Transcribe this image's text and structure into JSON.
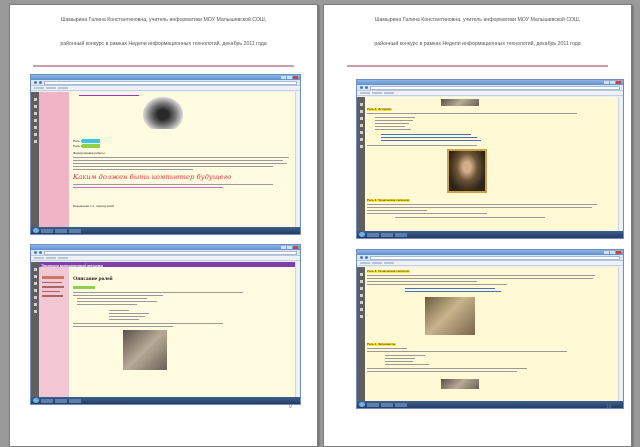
{
  "header": {
    "line1": "Шамырина Галина Константиновна, учитель информатики   МОУ Малышевской СОШ,",
    "line2": "районный конкурс в рамках Недели  информационных технологий, декабрь 2011 года"
  },
  "pages": {
    "left_number": "9",
    "right_number": "10"
  },
  "shot1": {
    "label_a": "Роль 1",
    "label_b": "Роль 2",
    "heading": "Формулировка работы:",
    "slogan": "Каким должен быть компьютер будущего",
    "footer": "Рецензентам: 1.1 - переход ролей"
  },
  "shot2": {
    "banner": "Эволюция компьютерной техники",
    "title": "Описание ролей"
  },
  "shot3": {
    "label_a": "Роль 2. Историки.",
    "label_b": "Роль 3. Технические писатели."
  },
  "shot4": {
    "label_a": "Роль 3. Технические писатели.",
    "label_b": "Роль 4. Экономисты."
  },
  "colors": {
    "sidebar_pink": "#f1b3c6",
    "content_cream": "#fffbe0",
    "slogan_red": "#e0323a",
    "header_rule": "#c9a0a6"
  }
}
